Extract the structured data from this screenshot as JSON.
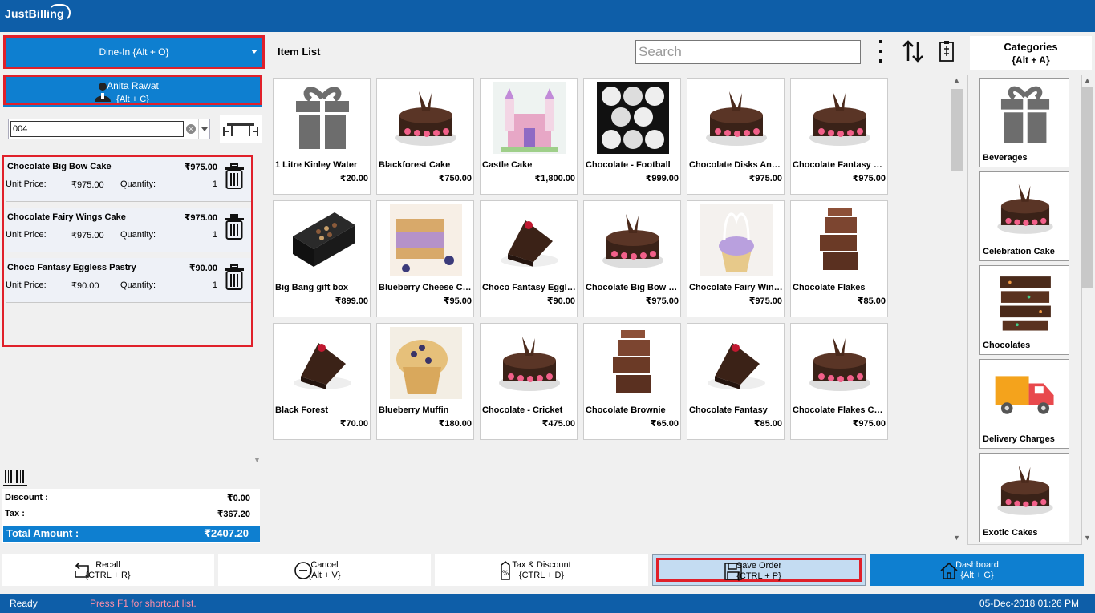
{
  "app": {
    "logo": "JustBilling"
  },
  "order": {
    "mode_label": "Dine-In {Alt + O}",
    "customer_name": "Anita Rawat",
    "customer_shortcut": "{Alt + C}",
    "table_search_value": "004"
  },
  "cart": {
    "unit_price_label": "Unit Price:",
    "quantity_label": "Quantity:",
    "items": [
      {
        "name": "Chocolate Big Bow Cake",
        "price": "₹975.00",
        "unit_price": "₹975.00",
        "quantity": "1"
      },
      {
        "name": "Chocolate Fairy Wings Cake",
        "price": "₹975.00",
        "unit_price": "₹975.00",
        "quantity": "1"
      },
      {
        "name": "Choco Fantasy Eggless Pastry",
        "price": "₹90.00",
        "unit_price": "₹90.00",
        "quantity": "1"
      }
    ]
  },
  "totals": {
    "discount_label": "Discount :",
    "discount_value": "₹0.00",
    "tax_label": "Tax :",
    "tax_value": "₹367.20",
    "total_label": "Total Amount :",
    "total_value": "₹2407.20"
  },
  "item_list": {
    "title": "Item List",
    "search_placeholder": "Search",
    "items": [
      {
        "name": "1 Litre Kinley Water",
        "price": "₹20.00",
        "icon": "gift-icon"
      },
      {
        "name": "Blackforest Cake",
        "price": "₹750.00",
        "icon": "cake-icon"
      },
      {
        "name": "Castle Cake",
        "price": "₹1,800.00",
        "icon": "castle-cake-icon"
      },
      {
        "name": "Chocolate - Football",
        "price": "₹999.00",
        "icon": "football-icon"
      },
      {
        "name": "Chocolate Disks And…",
        "price": "₹975.00",
        "icon": "cake-icon"
      },
      {
        "name": "Chocolate Fantasy C…",
        "price": "₹975.00",
        "icon": "cake-icon"
      },
      {
        "name": "Big Bang gift box",
        "price": "₹899.00",
        "icon": "gift-box-icon"
      },
      {
        "name": "Blueberry Cheese Ca…",
        "price": "₹95.00",
        "icon": "cheesecake-icon"
      },
      {
        "name": "Choco Fantasy Eggle…",
        "price": "₹90.00",
        "icon": "pastry-icon"
      },
      {
        "name": "Chocolate Big Bow C…",
        "price": "₹975.00",
        "icon": "cake-icon"
      },
      {
        "name": "Chocolate Fairy Win…",
        "price": "₹975.00",
        "icon": "cupcake-icon"
      },
      {
        "name": "Chocolate Flakes",
        "price": "₹85.00",
        "icon": "brownie-icon"
      },
      {
        "name": "Black Forest",
        "price": "₹70.00",
        "icon": "pastry-icon"
      },
      {
        "name": "Blueberry Muffin",
        "price": "₹180.00",
        "icon": "muffin-icon"
      },
      {
        "name": "Chocolate - Cricket",
        "price": "₹475.00",
        "icon": "cake-icon"
      },
      {
        "name": "Chocolate Brownie",
        "price": "₹65.00",
        "icon": "brownie-icon"
      },
      {
        "name": "Chocolate Fantasy",
        "price": "₹85.00",
        "icon": "pastry-icon"
      },
      {
        "name": "Chocolate Flakes Cake",
        "price": "₹975.00",
        "icon": "cake-icon"
      }
    ]
  },
  "categories": {
    "title": "Categories",
    "shortcut": "{Alt + A}",
    "items": [
      {
        "name": "Beverages",
        "icon": "gift-icon"
      },
      {
        "name": "Celebration Cake",
        "icon": "cake-icon"
      },
      {
        "name": "Chocolates",
        "icon": "chocolate-bar-icon"
      },
      {
        "name": "Delivery Charges",
        "icon": "delivery-truck-icon"
      },
      {
        "name": "Exotic Cakes",
        "icon": "cake-icon"
      }
    ]
  },
  "actions": {
    "recall": {
      "label": "Recall",
      "shortcut": "{CTRL + R}"
    },
    "cancel": {
      "label": "Cancel",
      "shortcut": "{Alt + V}"
    },
    "tax_discount": {
      "label": "Tax & Discount",
      "shortcut": "{CTRL + D}"
    },
    "save_order": {
      "label": "Save Order",
      "shortcut": "{CTRL + P}"
    },
    "dashboard": {
      "label": "Dashboard",
      "shortcut": "{Alt + G}"
    }
  },
  "status": {
    "state": "Ready",
    "hint": "Press F1 for shortcut list.",
    "datetime": "05-Dec-2018 01:26 PM"
  },
  "colors": {
    "brand_dark": "#0e5ea8",
    "brand": "#0e7fd0",
    "highlight_red": "#e0202a"
  }
}
